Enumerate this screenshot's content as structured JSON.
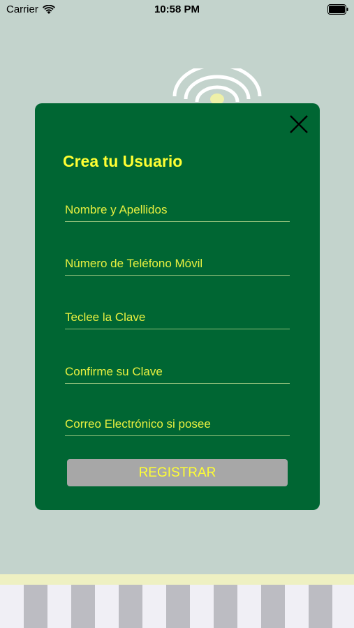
{
  "status_bar": {
    "carrier": "Carrier",
    "time": "10:58 PM"
  },
  "modal": {
    "title": "Crea tu Usuario",
    "fields": [
      {
        "placeholder": "Nombre y Apellidos",
        "value": ""
      },
      {
        "placeholder": "Número de Teléfono Móvil",
        "value": ""
      },
      {
        "placeholder": "Teclee la Clave",
        "value": ""
      },
      {
        "placeholder": "Confirme su Clave",
        "value": ""
      },
      {
        "placeholder": "Correo Electrónico si posee",
        "value": ""
      }
    ],
    "register_label": "REGISTRAR"
  },
  "icons": {
    "close": "close-icon",
    "wifi": "wifi-icon",
    "battery": "battery-icon",
    "logo": "wifi-logo-icon"
  },
  "colors": {
    "modal_bg": "#006633",
    "accent_text": "#ffff33",
    "button_bg": "#a7a7a7",
    "page_bg": "#c3d3cc"
  }
}
